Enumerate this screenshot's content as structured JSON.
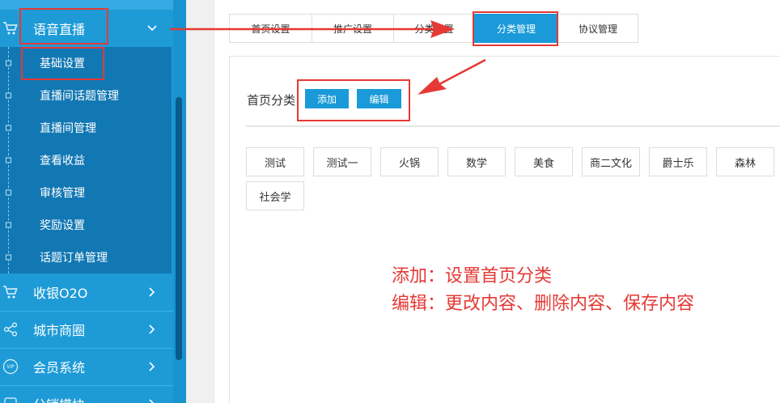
{
  "sidebar": {
    "voice_live": {
      "label": "语音直播",
      "icon": "cart-icon"
    },
    "submenu": [
      {
        "label": "基础设置"
      },
      {
        "label": "直播间话题管理"
      },
      {
        "label": "直播间管理"
      },
      {
        "label": "查看收益"
      },
      {
        "label": "审核管理"
      },
      {
        "label": "奖励设置"
      },
      {
        "label": "话题订单管理"
      }
    ],
    "cashier": {
      "label": "收银O2O",
      "icon": "cart-icon"
    },
    "city_mall": {
      "label": "城市商圈",
      "icon": "share-icon"
    },
    "member": {
      "label": "会员系统",
      "icon": "vip-icon",
      "badge": "VIP"
    },
    "distribution": {
      "label": "分销模块"
    }
  },
  "tabs": [
    {
      "label": "首页设置"
    },
    {
      "label": "推广设置"
    },
    {
      "label": "分类设置"
    },
    {
      "label": "分类管理",
      "active": true
    },
    {
      "label": "协议管理"
    }
  ],
  "section": {
    "title": "首页分类",
    "add_label": "添加",
    "edit_label": "编辑"
  },
  "categories": [
    "测试",
    "测试一",
    "火锅",
    "数学",
    "美食",
    "商二文化",
    "爵士乐",
    "森林",
    "社会学"
  ],
  "annotations": {
    "line1": "添加：设置首页分类",
    "line2": "编辑：更改内容、删除内容、保存内容"
  },
  "colors": {
    "accent": "#1a9ad8",
    "sidebar": "#1e9bd7",
    "submenu": "#1278b4",
    "annotation": "#e53935"
  }
}
